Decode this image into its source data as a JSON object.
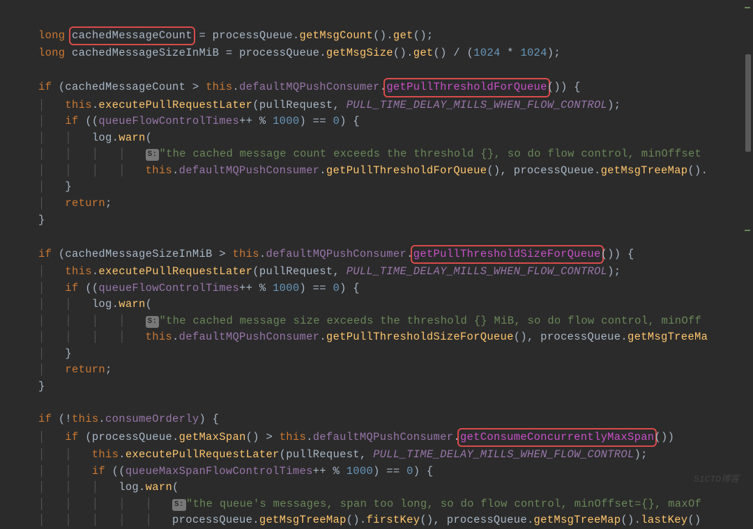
{
  "code": {
    "l1_kw": "long ",
    "l1_var": "cachedMessageCount",
    "l1_eq": " = ",
    "l1_pq": "processQueue",
    "l1_d": ".",
    "l1_m": "getMsgCount",
    "l1_p": "()",
    "l1_m2": "get",
    "l1_end": "();",
    "l2_kw": "long ",
    "l2_var": "cachedMessageSizeInMiB",
    "l2_eq": " = ",
    "l2_pq": "processQueue",
    "l2_m": "getMsgSize",
    "l2_p": "()",
    "l2_m2": "get",
    "l2_div": "() / (",
    "l2_n1": "1024",
    "l2_mul": " * ",
    "l2_n2": "1024",
    "l2_end": ");",
    "l4_if": "if ",
    "l4_op": "(",
    "l4_var": "cachedMessageCount",
    "l4_gt": " > ",
    "l4_this": "this",
    "l4_d": ".",
    "l4_fld": "defaultMQPushConsumer",
    "l4_m": "getPullThresholdForQueue",
    "l4_end": "()) {",
    "l5_this": "this",
    "l5_m": "executePullRequestLater",
    "l5_op": "(",
    "l5_arg": "pullRequest",
    "l5_c": ", ",
    "l5_const": "PULL_TIME_DELAY_MILLS_WHEN_FLOW_CONTROL",
    "l5_end": ");",
    "l6_if": "if ",
    "l6_op": "((",
    "l6_fld": "queueFlowControlTimes",
    "l6_inc": "++ % ",
    "l6_n": "1000",
    "l6_eq": ") == ",
    "l6_z": "0",
    "l6_end": ") {",
    "l7_log": "log",
    "l7_m": "warn",
    "l7_op": "(",
    "l8_s": "S:",
    "l8_str": "\"the cached message count exceeds the threshold {}, so do flow control, minOffset",
    "l9_this": "this",
    "l9_fld": "defaultMQPushConsumer",
    "l9_m": "getPullThresholdForQueue",
    "l9_p": "()",
    "l9_c": ", ",
    "l9_pq": "processQueue",
    "l9_m2": "getMsgTreeMap",
    "l9_end": "().",
    "l10": "}",
    "l11_ret": "return",
    "l11_s": ";",
    "l12": "}",
    "l14_if": "if ",
    "l14_op": "(",
    "l14_var": "cachedMessageSizeInMiB",
    "l14_gt": " > ",
    "l14_this": "this",
    "l14_fld": "defaultMQPushConsumer",
    "l14_m": "getPullThresholdSizeForQueue",
    "l14_end": "()) {",
    "l15_this": "this",
    "l15_m": "executePullRequestLater",
    "l15_op": "(",
    "l15_arg": "pullRequest",
    "l15_c": ", ",
    "l15_const": "PULL_TIME_DELAY_MILLS_WHEN_FLOW_CONTROL",
    "l15_end": ");",
    "l16_if": "if ",
    "l16_op": "((",
    "l16_fld": "queueFlowControlTimes",
    "l16_inc": "++ % ",
    "l16_n": "1000",
    "l16_eq": ") == ",
    "l16_z": "0",
    "l16_end": ") {",
    "l17_log": "log",
    "l17_m": "warn",
    "l17_op": "(",
    "l18_s": "S:",
    "l18_str": "\"the cached message size exceeds the threshold {} MiB, so do flow control, minOff",
    "l19_this": "this",
    "l19_fld": "defaultMQPushConsumer",
    "l19_m": "getPullThresholdSizeForQueue",
    "l19_p": "()",
    "l19_c": ", ",
    "l19_pq": "processQueue",
    "l19_m2": "getMsgTreeMa",
    "l20": "}",
    "l21_ret": "return",
    "l21_s": ";",
    "l22": "}",
    "l24_if": "if ",
    "l24_op": "(!",
    "l24_this": "this",
    "l24_fld": "consumeOrderly",
    "l24_end": ") {",
    "l25_if": "if ",
    "l25_op": "(",
    "l25_pq": "processQueue",
    "l25_m": "getMaxSpan",
    "l25_p": "()",
    "l25_gt": " > ",
    "l25_this": "this",
    "l25_fld": "defaultMQPushConsumer",
    "l25_m2": "getConsumeConcurrentlyMaxSpan",
    "l25_end": "())",
    "l26_this": "this",
    "l26_m": "executePullRequestLater",
    "l26_op": "(",
    "l26_arg": "pullRequest",
    "l26_c": ", ",
    "l26_const": "PULL_TIME_DELAY_MILLS_WHEN_FLOW_CONTROL",
    "l26_end": ");",
    "l27_if": "if ",
    "l27_op": "((",
    "l27_fld": "queueMaxSpanFlowControlTimes",
    "l27_inc": "++ % ",
    "l27_n": "1000",
    "l27_eq": ") == ",
    "l27_z": "0",
    "l27_end": ") {",
    "l28_log": "log",
    "l28_m": "warn",
    "l28_op": "(",
    "l29_s": "S:",
    "l29_str": "\"the queue's messages, span too long, so do flow control, minOffset={}, maxOf",
    "l30_pq": "processQueue",
    "l30_m": "getMsgTreeMap",
    "l30_p": "()",
    "l30_m2": "firstKey",
    "l30_p2": "()",
    "l30_c": ", ",
    "l30_pq2": "processQueue",
    "l30_m3": "getMsgTreeMap",
    "l30_p3": "()",
    "l30_m4": "lastKey",
    "l30_end": "()"
  },
  "watermark": "51CTO博客"
}
